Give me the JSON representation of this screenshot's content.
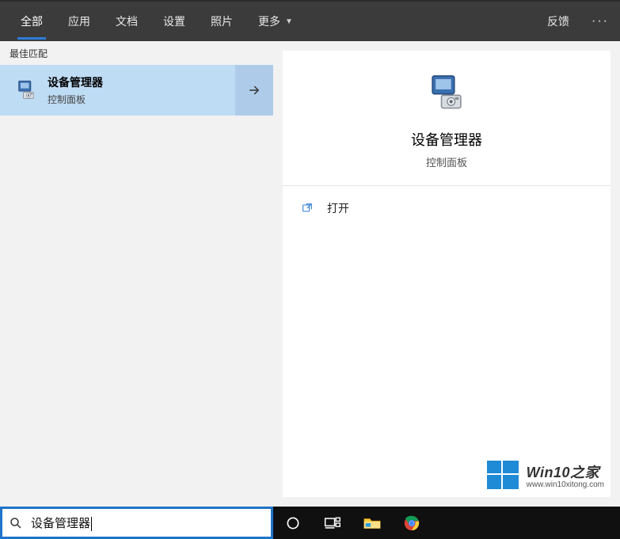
{
  "tabs": {
    "all": "全部",
    "apps": "应用",
    "docs": "文档",
    "settings": "设置",
    "photos": "照片",
    "more": "更多"
  },
  "header": {
    "feedback": "反馈",
    "more_symbol": "···"
  },
  "results": {
    "section_label": "最佳匹配",
    "item0": {
      "title": "设备管理器",
      "subtitle": "控制面板"
    }
  },
  "preview": {
    "title": "设备管理器",
    "subtitle": "控制面板",
    "actions": {
      "open": "打开"
    }
  },
  "search": {
    "query": "设备管理器"
  },
  "watermark": {
    "line1": "Win10之家",
    "line2": "www.win10xitong.com"
  },
  "colors": {
    "accent": "#2e7cd6",
    "selection": "#bfdcf5",
    "tabbar": "#3b3b3b"
  }
}
